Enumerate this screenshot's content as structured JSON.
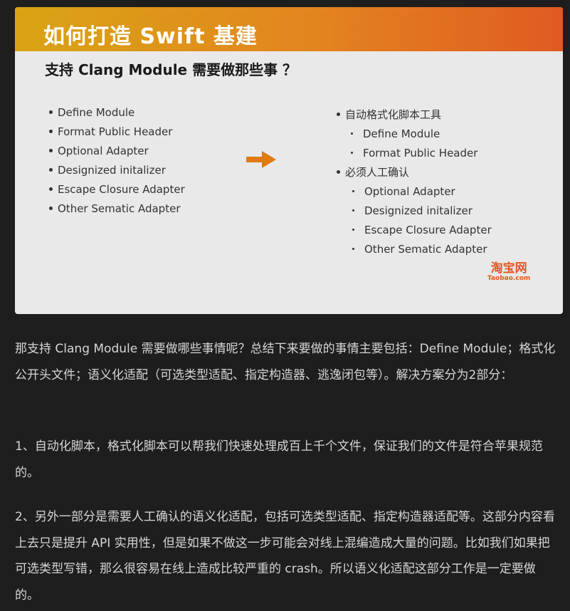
{
  "slide": {
    "title": "如何打造 Swift 基建",
    "subtitle": "支持 Clang Module 需要做那些事 ？",
    "left_items": [
      "Define Module",
      "Format Public Header",
      "Optional Adapter",
      "Designized initalizer",
      "Escape Closure Adapter",
      "Other Sematic Adapter"
    ],
    "right": {
      "group1_title": "自动格式化脚本工具",
      "group1_items": [
        "Define Module",
        "Format Public Header"
      ],
      "group2_title": "必须人工确认",
      "group2_items": [
        "Optional Adapter",
        "Designized initalizer",
        "Escape Closure Adapter",
        "Other Sematic Adapter"
      ]
    },
    "arrow_icon": "right-arrow-icon",
    "arrow_color": "#e07a12",
    "logo_cn": "淘宝网",
    "logo_en": "Taobao.com",
    "header_gradient": [
      "#d9a414",
      "#e05a22"
    ]
  },
  "paragraphs": [
    "那支持 Clang Module 需要做哪些事情呢？总结下来要做的事情主要包括：Define Module；格式化公开头文件；语义化适配（可选类型适配、指定构造器、逃逸闭包等）。解决方案分为2部分：",
    "1、自动化脚本，格式化脚本可以帮我们快速处理成百上千个文件，保证我们的文件是符合苹果规范的。",
    "2、另外一部分是需要人工确认的语义化适配，包括可选类型适配、指定构造器适配等。这部分内容看上去只是提升 API 实用性，但是如果不做这一步可能会对线上混编造成大量的问题。比如我们如果把可选类型写错，那么很容易在线上造成比较严重的 crash。所以语义化适配这部分工作是一定要做的。"
  ]
}
